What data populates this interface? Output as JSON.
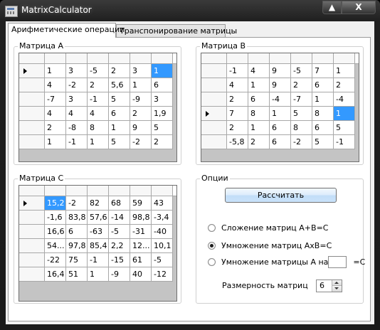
{
  "window": {
    "title": "MatrixCalculator",
    "maximize_glyph": "▲",
    "close_glyph": "X"
  },
  "tabs": [
    {
      "label": "Арифметические операции"
    },
    {
      "label": "Транспонирование матрицы"
    }
  ],
  "matrix_a": {
    "label": "Матрица А",
    "rows": [
      [
        "1",
        "3",
        "-5",
        "2",
        "3",
        "1"
      ],
      [
        "4",
        "-2",
        "2",
        "5,6",
        "1",
        "6"
      ],
      [
        "-7",
        "3",
        "-1",
        "5",
        "-9",
        "3"
      ],
      [
        "4",
        "4",
        "4",
        "6",
        "2",
        "1,9"
      ],
      [
        "2",
        "-8",
        "8",
        "1",
        "9",
        "5"
      ],
      [
        "1",
        "-1",
        "1",
        "5",
        "-2",
        "2"
      ]
    ],
    "current_row": 0,
    "selected_cell": [
      0,
      5
    ]
  },
  "matrix_b": {
    "label": "Матрица В",
    "rows": [
      [
        "-1",
        "4",
        "9",
        "-5",
        "7",
        "1"
      ],
      [
        "4",
        "1",
        "9",
        "2",
        "6",
        "2"
      ],
      [
        "2",
        "6",
        "-4",
        "-7",
        "1",
        "-4"
      ],
      [
        "7",
        "8",
        "1",
        "5",
        "8",
        "1"
      ],
      [
        "2",
        "1",
        "6",
        "8",
        "6",
        "5"
      ],
      [
        "-5,8",
        "2",
        "6",
        "-2",
        "5",
        "-1"
      ]
    ],
    "current_row": 3,
    "selected_cell": [
      3,
      5
    ]
  },
  "matrix_c": {
    "label": "Матрица С",
    "rows": [
      [
        "15,2",
        "-2",
        "82",
        "68",
        "59",
        "43"
      ],
      [
        "-1,6",
        "83,8",
        "57,6",
        "-14",
        "98,8",
        "-3,4"
      ],
      [
        "16,6",
        "6",
        "-63",
        "-5",
        "-31",
        "-40"
      ],
      [
        "54...",
        "97,8",
        "85,4",
        "2,2",
        "12...",
        "10,1"
      ],
      [
        "-22",
        "75",
        "-1",
        "-15",
        "61",
        "-5"
      ],
      [
        "16,4",
        "51",
        "1",
        "-9",
        "40",
        "-12"
      ]
    ],
    "current_row": 0,
    "selected_cell": [
      0,
      0
    ]
  },
  "options": {
    "label": "Опции",
    "calculate_button": "Рассчитать",
    "radio_add": "Сложение матриц А+В=С",
    "radio_multiply": "Умножение матриц АхВ=С",
    "radio_scalar_prefix": "Умножение матрицы А на",
    "radio_scalar_suffix": "=С",
    "scalar_value": "",
    "selected_option": "multiply",
    "dimension_label": "Размерность матриц",
    "dimension_value": "6"
  }
}
